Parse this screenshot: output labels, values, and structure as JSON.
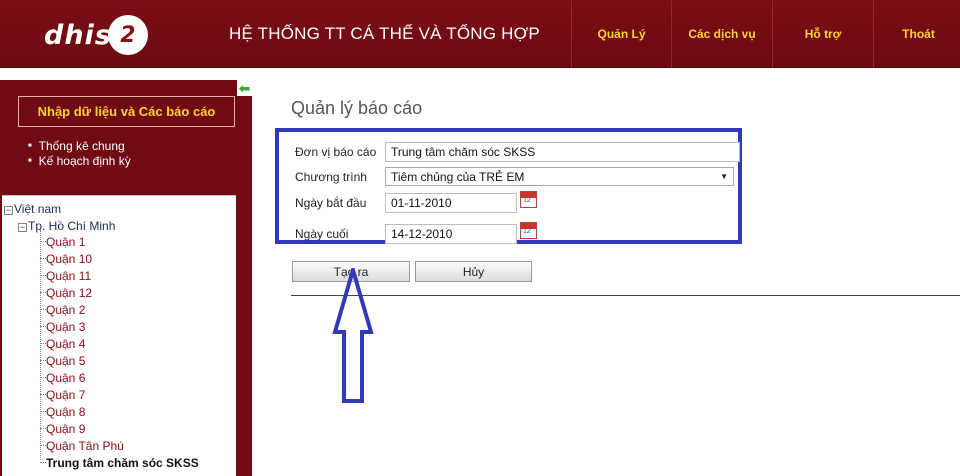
{
  "header": {
    "logo_text": "dhis",
    "logo_number": "2",
    "system_title": "HỆ THỐNG TT CÁ THỂ VÀ TỔNG HỢP",
    "nav": [
      "Quản Lý",
      "Các dịch vụ",
      "Hỗ trợ",
      "Thoát"
    ]
  },
  "sidebar": {
    "heading": "Nhập dữ liệu và Các báo cáo",
    "links": [
      "Thống kê chung",
      "Kế hoạch định kỳ"
    ],
    "tree": {
      "root": "Việt nam",
      "city": "Tp. Hồ Chí Minh",
      "children": [
        "Quận 1",
        "Quận 10",
        "Quận 11",
        "Quận 12",
        "Quận 2",
        "Quận 3",
        "Quận 4",
        "Quận 5",
        "Quận 6",
        "Quận 7",
        "Quận 8",
        "Quận 9",
        "Quận Tân Phú"
      ],
      "selected": "Trung tâm chăm sóc SKSS"
    }
  },
  "main": {
    "title": "Quản lý báo cáo",
    "form": {
      "unit_label": "Đơn vị báo cáo",
      "unit_value": "Trung tâm chăm sóc SKSS",
      "program_label": "Chương trình",
      "program_value": "Tiêm chủng của TRẺ EM",
      "start_label": "Ngày bắt đầu",
      "start_value": "01-11-2010",
      "end_label": "Ngày cuối",
      "end_value": "14-12-2010"
    },
    "buttons": {
      "create": "Tạo ra",
      "cancel": "Hủy"
    }
  },
  "colors": {
    "header_bg": "#7a0c15",
    "nav_text": "#ffd233",
    "annotation": "#3338b9",
    "tree_leaf": "#8a0c16"
  }
}
